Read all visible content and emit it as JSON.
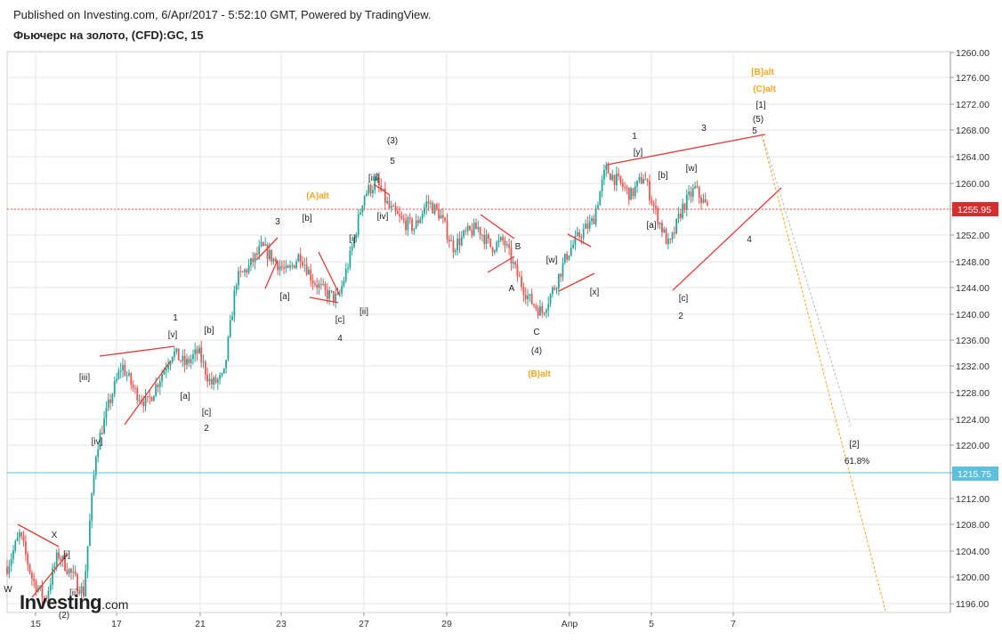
{
  "header": {
    "published": "Published on Investing.com, 6/Apr/2017 - 5:52:10 GMT, Powered by TradingView.",
    "title": "Фьючерс на золото, (CFD):GC, 15"
  },
  "logo": {
    "brand": "Investing",
    "suffix": ".com"
  },
  "chart_data": {
    "type": "line",
    "series": [
      {
        "values": [
          1201,
          1206,
          1199,
          1196,
          1203,
          1200,
          1197,
          1219,
          1226,
          1232,
          1228,
          1226,
          1230,
          1234,
          1232,
          1234,
          1229,
          1230,
          1245,
          1247,
          1250,
          1248,
          1246,
          1249,
          1245,
          1243,
          1242,
          1249,
          1258,
          1260,
          1256,
          1254,
          1253,
          1257,
          1255,
          1250,
          1252,
          1253,
          1250,
          1251,
          1246,
          1242,
          1240,
          1244,
          1249,
          1252,
          1254,
          1262,
          1260,
          1258,
          1261,
          1255,
          1250,
          1256,
          1259,
          1255.95
        ],
        "color": "#26a69a"
      }
    ],
    "y_ticks": [
      "1260.00",
      "1276.00",
      "1272.00",
      "1268.00",
      "1264.00",
      "1260.00",
      "1256.00",
      "1252.00",
      "1248.00",
      "1244.00",
      "1240.00",
      "1236.00",
      "1232.00",
      "1228.00",
      "1224.00",
      "1220.00",
      "1216.00",
      "1212.00",
      "1208.00",
      "1204.00",
      "1200.00",
      "1196.00"
    ],
    "x_ticks": [
      "15",
      "17",
      "21",
      "23",
      "27",
      "29",
      "Апр",
      "5",
      "7"
    ],
    "ylim": [
      1194,
      1280
    ],
    "price_labels": [
      {
        "text": "1255.95",
        "value": 1255.95,
        "color": "#d32f2f"
      },
      {
        "text": "1215.75",
        "value": 1215.75,
        "color": "#5bc0de"
      }
    ],
    "wave_labels_black": [
      "W",
      "X",
      "[i]",
      "[ii]",
      "(2)",
      "[iii]",
      "[iv]",
      "[v]",
      "1",
      "[a]",
      "[b]",
      "[c]",
      "2",
      "3",
      "[a]",
      "[b]",
      "[c]",
      "4",
      "(3)",
      "5",
      "[iii]",
      "[iv]",
      "[i]",
      "[ii]",
      "B",
      "A",
      "C",
      "(4)",
      "[w]",
      "[x]",
      "1",
      "[y]",
      "[b]",
      "[a]",
      "[w]",
      "[c]",
      "2",
      "3",
      "5",
      "(5)",
      "[1]",
      "4",
      "[2]",
      "61.8%"
    ],
    "wave_labels_orange": [
      "(A)alt",
      "(B)alt",
      "[B]alt",
      "(C)alt"
    ],
    "colors": {
      "up": "#26a69a",
      "down": "#ef5350",
      "trend": "#e53935",
      "projection": "#f5a623",
      "grid": "#e6e6e6"
    }
  }
}
